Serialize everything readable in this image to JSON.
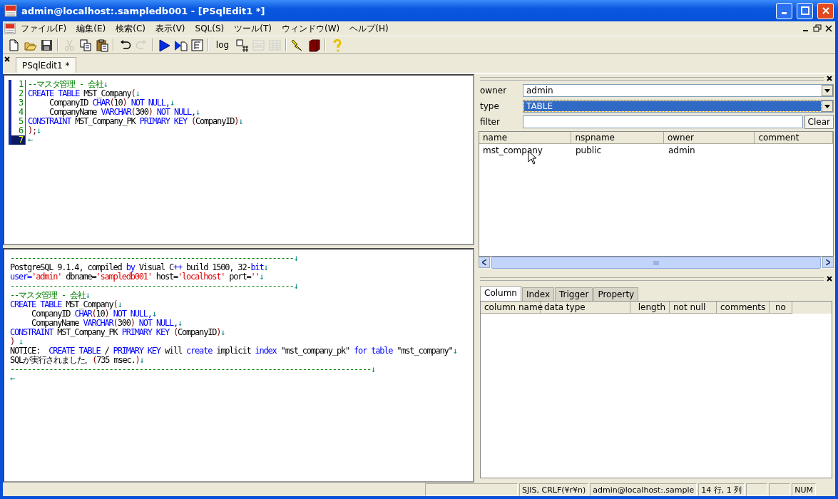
{
  "window": {
    "title": "admin@localhost:.sampledb001 - [PSqlEdit1 *]"
  },
  "menu": [
    "ファイル(F)",
    "編集(E)",
    "検索(C)",
    "表示(V)",
    "SQL(S)",
    "ツール(T)",
    "ウィンドウ(W)",
    "ヘルプ(H)"
  ],
  "toolbar": [
    {
      "kind": "new",
      "disabled": false
    },
    {
      "kind": "open",
      "disabled": false
    },
    {
      "kind": "save",
      "disabled": false
    },
    {
      "kind": "sep"
    },
    {
      "kind": "cut",
      "disabled": true
    },
    {
      "kind": "copy",
      "disabled": false
    },
    {
      "kind": "paste",
      "disabled": false
    },
    {
      "kind": "sep"
    },
    {
      "kind": "undo",
      "disabled": false
    },
    {
      "kind": "redo",
      "disabled": true
    },
    {
      "kind": "sep"
    },
    {
      "kind": "run",
      "disabled": false
    },
    {
      "kind": "runpage",
      "disabled": false
    },
    {
      "kind": "plan",
      "disabled": false
    },
    {
      "kind": "sep"
    },
    {
      "kind": "log",
      "label": "log",
      "disabled": false
    },
    {
      "kind": "grid",
      "disabled": false
    },
    {
      "kind": "gridarrows",
      "disabled": true
    },
    {
      "kind": "gridlines",
      "disabled": true
    },
    {
      "kind": "sep"
    },
    {
      "kind": "bolt",
      "disabled": false
    },
    {
      "kind": "book",
      "disabled": false
    },
    {
      "kind": "sep"
    },
    {
      "kind": "help",
      "disabled": false
    }
  ],
  "doc_tabs": [
    {
      "label": "PSqlEdit1 *",
      "selected": true
    }
  ],
  "editor": {
    "lines": [
      {
        "number": "1",
        "current": false,
        "tokens": [
          {
            "kind": "comment",
            "text": "--マスタ管理 - 会社"
          },
          {
            "kind": "mark",
            "text": "↓"
          }
        ]
      },
      {
        "number": "2",
        "current": false,
        "tokens": [
          {
            "kind": "kw",
            "text": "CREATE TABLE"
          },
          {
            "kind": "plain",
            "text": " MST_Company"
          },
          {
            "kind": "paren",
            "text": "("
          },
          {
            "kind": "mark",
            "text": "↓"
          }
        ]
      },
      {
        "number": "3",
        "current": false,
        "tokens": [
          {
            "kind": "plain",
            "text": "     CompanyID "
          },
          {
            "kind": "kw",
            "text": "CHAR"
          },
          {
            "kind": "paren",
            "text": "("
          },
          {
            "kind": "plain",
            "text": "10"
          },
          {
            "kind": "paren",
            "text": ") "
          },
          {
            "kind": "kw",
            "text": "NOT NULL,"
          },
          {
            "kind": "mark",
            "text": "↓"
          }
        ]
      },
      {
        "number": "4",
        "current": false,
        "tokens": [
          {
            "kind": "plain",
            "text": "     CompanyName "
          },
          {
            "kind": "kw",
            "text": "VARCHAR"
          },
          {
            "kind": "paren",
            "text": "("
          },
          {
            "kind": "plain",
            "text": "300"
          },
          {
            "kind": "paren",
            "text": ") "
          },
          {
            "kind": "kw",
            "text": "NOT NULL,"
          },
          {
            "kind": "mark",
            "text": "↓"
          }
        ]
      },
      {
        "number": "5",
        "current": false,
        "tokens": [
          {
            "kind": "kw",
            "text": "CONSTRAINT"
          },
          {
            "kind": "plain",
            "text": " MST_Company_PK "
          },
          {
            "kind": "kw",
            "text": "PRIMARY KEY"
          },
          {
            "kind": "paren",
            "text": " ("
          },
          {
            "kind": "plain",
            "text": "CompanyID"
          },
          {
            "kind": "paren",
            "text": ")"
          },
          {
            "kind": "mark",
            "text": "↓"
          }
        ]
      },
      {
        "number": "6",
        "current": false,
        "tokens": [
          {
            "kind": "paren",
            "text": ");"
          },
          {
            "kind": "mark",
            "text": "↓"
          }
        ]
      },
      {
        "number": "7",
        "current": true,
        "tokens": [
          {
            "kind": "mark",
            "text": "←"
          }
        ]
      }
    ]
  },
  "output": {
    "lines": [
      [
        {
          "kind": "comment",
          "text": "------------------------------------------------------------------"
        },
        {
          "kind": "mark",
          "text": "↓"
        }
      ],
      [
        {
          "kind": "plain",
          "text": "PostgreSQL 9.1.4, compiled "
        },
        {
          "kind": "kw",
          "text": "by"
        },
        {
          "kind": "plain",
          "text": " Visual C"
        },
        {
          "kind": "kw",
          "text": "++"
        },
        {
          "kind": "plain",
          "text": " build 1500, 32-"
        },
        {
          "kind": "kw",
          "text": "bit"
        },
        {
          "kind": "mark",
          "text": "↓"
        }
      ],
      [
        {
          "kind": "kw",
          "text": "user="
        },
        {
          "kind": "str",
          "text": "'admin'"
        },
        {
          "kind": "plain",
          "text": " dbname="
        },
        {
          "kind": "str",
          "text": "'sampledb001'"
        },
        {
          "kind": "plain",
          "text": " host="
        },
        {
          "kind": "str",
          "text": "'localhost'"
        },
        {
          "kind": "plain",
          "text": " port="
        },
        {
          "kind": "str",
          "text": "''"
        },
        {
          "kind": "mark",
          "text": "↓"
        }
      ],
      [
        {
          "kind": "comment",
          "text": "------------------------------------------------------------------"
        },
        {
          "kind": "mark",
          "text": "↓"
        }
      ],
      [
        {
          "kind": "comment",
          "text": "--マスタ管理 - 会社"
        },
        {
          "kind": "mark",
          "text": "↓"
        }
      ],
      [
        {
          "kind": "kw",
          "text": "CREATE TABLE"
        },
        {
          "kind": "plain",
          "text": " MST_Company"
        },
        {
          "kind": "paren",
          "text": "("
        },
        {
          "kind": "mark",
          "text": "↓"
        }
      ],
      [
        {
          "kind": "plain",
          "text": "     CompanyID "
        },
        {
          "kind": "kw",
          "text": "CHAR"
        },
        {
          "kind": "paren",
          "text": "("
        },
        {
          "kind": "plain",
          "text": "10"
        },
        {
          "kind": "paren",
          "text": ") "
        },
        {
          "kind": "kw",
          "text": "NOT NULL,"
        },
        {
          "kind": "mark",
          "text": "↓"
        }
      ],
      [
        {
          "kind": "plain",
          "text": "     CompanyName "
        },
        {
          "kind": "kw",
          "text": "VARCHAR"
        },
        {
          "kind": "paren",
          "text": "("
        },
        {
          "kind": "plain",
          "text": "300"
        },
        {
          "kind": "paren",
          "text": ") "
        },
        {
          "kind": "kw",
          "text": "NOT NULL,"
        },
        {
          "kind": "mark",
          "text": "↓"
        }
      ],
      [
        {
          "kind": "kw",
          "text": "CONSTRAINT"
        },
        {
          "kind": "plain",
          "text": " MST_Company_PK "
        },
        {
          "kind": "kw",
          "text": "PRIMARY KEY"
        },
        {
          "kind": "paren",
          "text": " ("
        },
        {
          "kind": "plain",
          "text": "CompanyID"
        },
        {
          "kind": "paren",
          "text": ")"
        },
        {
          "kind": "mark",
          "text": "↓"
        }
      ],
      [
        {
          "kind": "paren",
          "text": ") "
        },
        {
          "kind": "mark",
          "text": "↓"
        }
      ],
      [
        {
          "kind": "plain",
          "text": "NOTICE:  "
        },
        {
          "kind": "kw",
          "text": "CREATE TABLE"
        },
        {
          "kind": "plain",
          "text": " / "
        },
        {
          "kind": "kw",
          "text": "PRIMARY KEY"
        },
        {
          "kind": "plain",
          "text": " will "
        },
        {
          "kind": "kw",
          "text": "create"
        },
        {
          "kind": "plain",
          "text": " implicit "
        },
        {
          "kind": "kw",
          "text": "index"
        },
        {
          "kind": "plain",
          "text": " \"mst_company_pk\" "
        },
        {
          "kind": "kw",
          "text": "for table"
        },
        {
          "kind": "plain",
          "text": " \"mst_company\""
        },
        {
          "kind": "mark",
          "text": "↓"
        }
      ],
      [
        {
          "kind": "plain",
          "text": "SQLが実行されました。"
        },
        {
          "kind": "paren",
          "text": "("
        },
        {
          "kind": "plain",
          "text": "735 msec."
        },
        {
          "kind": "paren",
          "text": ")"
        },
        {
          "kind": "mark",
          "text": "↓"
        }
      ],
      [
        {
          "kind": "comment",
          "text": "------------------------------------------------------------------------------------"
        },
        {
          "kind": "mark",
          "text": "↓"
        }
      ],
      [
        {
          "kind": "mark",
          "text": "←"
        }
      ]
    ]
  },
  "object_browser": {
    "owner_label": "owner",
    "owner": "admin",
    "type_label": "type",
    "type": "TABLE",
    "filter_label": "filter",
    "clear_button": "Clear",
    "columns": [
      "name",
      "nspname",
      "owner",
      "comment"
    ],
    "rows": [
      [
        "mst_company",
        "public",
        "admin"
      ]
    ]
  },
  "detail": {
    "tabs": [
      {
        "label": "Column",
        "selected": true
      },
      {
        "label": "Index",
        "selected": false
      },
      {
        "label": "Trigger",
        "selected": false
      },
      {
        "label": "Property",
        "selected": false
      }
    ],
    "columns": [
      "column name",
      "data type",
      "length",
      "not null",
      "comments",
      "no"
    ]
  },
  "status_bar": [
    "SJIS, CRLF(¥r¥n)",
    "admin@localhost:.sample",
    "14 行, 1 列",
    "NUM"
  ]
}
